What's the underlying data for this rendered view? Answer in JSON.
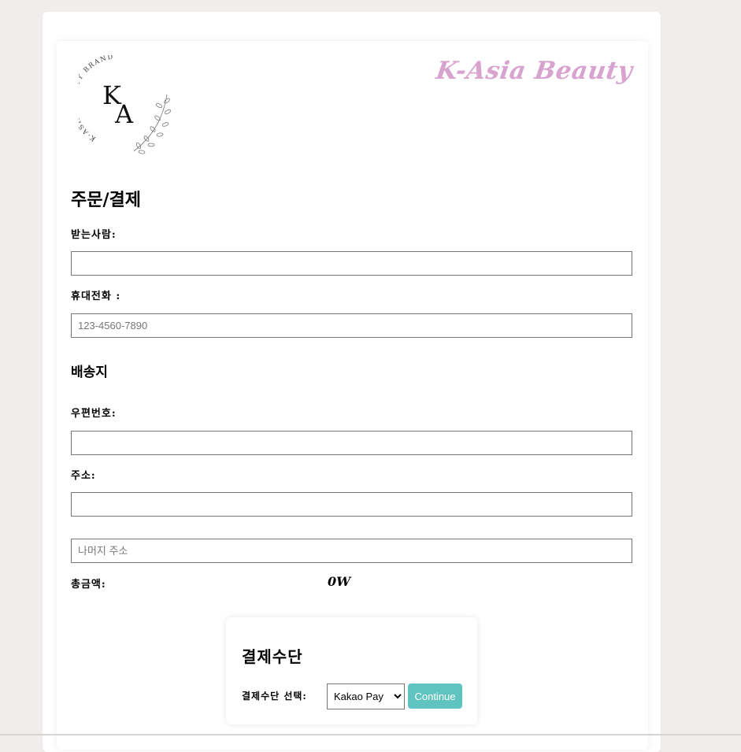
{
  "brand": {
    "logo_text": "K-ASIA BEAUTY BRAND",
    "logo_monogram": "KA",
    "title": "K-Asia Beauty",
    "title_color": "#d9a3cf"
  },
  "order": {
    "heading": "주문/결제",
    "recipient_label": "받는사람:",
    "recipient_value": "",
    "phone_label": "휴대전화 :",
    "phone_placeholder": "123-4560-7890"
  },
  "shipping": {
    "heading": "배송지",
    "zipcode_label": "우편번호:",
    "address_label": "주소:",
    "address_detail_placeholder": "나머지 주소",
    "total_label": "총금액:",
    "total_value": "0W"
  },
  "payment": {
    "heading": "결제수단",
    "select_label": "결제수단 선택:",
    "selected_option": "Kakao Pay",
    "continue_label": "Continue",
    "button_color": "#5fc4c0"
  }
}
